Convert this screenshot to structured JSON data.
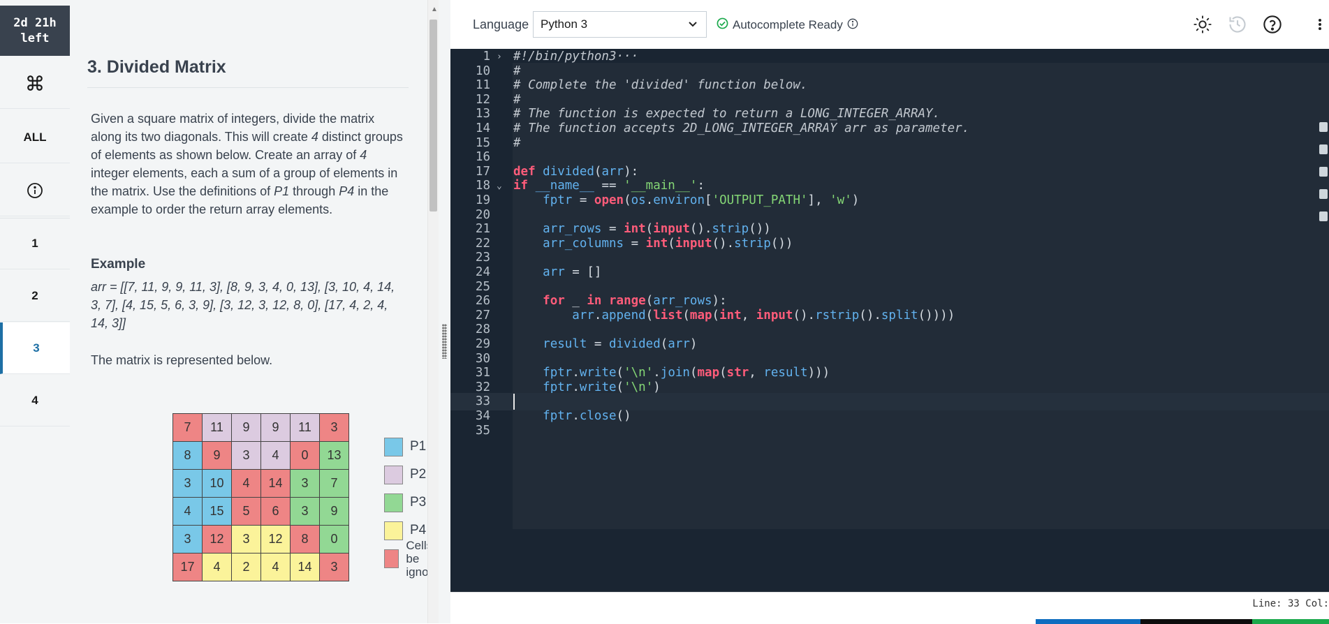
{
  "nav": {
    "timer_line1": "2d 21h",
    "timer_line2": "left",
    "all_label": "ALL",
    "items": [
      "1",
      "2",
      "3",
      "4"
    ],
    "active_item": "3"
  },
  "problem": {
    "title": "3. Divided Matrix",
    "p1_a": "Given a square matrix of integers, divide the matrix along its two diagonals. This will create ",
    "p1_n1": "4",
    "p1_b": " distinct groups of elements as shown below. Create an array of ",
    "p1_n2": "4",
    "p1_c": " integer elements, each a sum of a group of elements in the matrix. Use the definitions of ",
    "p1_n3": "P1",
    "p1_d": " through ",
    "p1_n4": "P4",
    "p1_e": " in the example to order the return array elements.",
    "example_heading": "Example",
    "example_arr": "arr = [[7, 11, 9, 9, 11, 3], [8, 9, 3, 4, 0, 13], [3, 10, 4, 14, 3, 7], [4, 15, 5, 6, 3, 9], [3, 12, 3, 12, 8, 0], [17, 4, 2, 4, 14, 3]]",
    "represented": "The matrix is represented below.",
    "matrix": [
      [
        {
          "v": "7",
          "g": "ig"
        },
        {
          "v": "11",
          "g": "p2"
        },
        {
          "v": "9",
          "g": "p2"
        },
        {
          "v": "9",
          "g": "p2"
        },
        {
          "v": "11",
          "g": "p2"
        },
        {
          "v": "3",
          "g": "ig"
        }
      ],
      [
        {
          "v": "8",
          "g": "p1"
        },
        {
          "v": "9",
          "g": "ig"
        },
        {
          "v": "3",
          "g": "p2"
        },
        {
          "v": "4",
          "g": "p2"
        },
        {
          "v": "0",
          "g": "ig"
        },
        {
          "v": "13",
          "g": "p3"
        }
      ],
      [
        {
          "v": "3",
          "g": "p1"
        },
        {
          "v": "10",
          "g": "p1"
        },
        {
          "v": "4",
          "g": "ig"
        },
        {
          "v": "14",
          "g": "ig"
        },
        {
          "v": "3",
          "g": "p3"
        },
        {
          "v": "7",
          "g": "p3"
        }
      ],
      [
        {
          "v": "4",
          "g": "p1"
        },
        {
          "v": "15",
          "g": "p1"
        },
        {
          "v": "5",
          "g": "ig"
        },
        {
          "v": "6",
          "g": "ig"
        },
        {
          "v": "3",
          "g": "p3"
        },
        {
          "v": "9",
          "g": "p3"
        }
      ],
      [
        {
          "v": "3",
          "g": "p1"
        },
        {
          "v": "12",
          "g": "ig"
        },
        {
          "v": "3",
          "g": "p4"
        },
        {
          "v": "12",
          "g": "p4"
        },
        {
          "v": "8",
          "g": "ig"
        },
        {
          "v": "0",
          "g": "p3"
        }
      ],
      [
        {
          "v": "17",
          "g": "ig"
        },
        {
          "v": "4",
          "g": "p4"
        },
        {
          "v": "2",
          "g": "p4"
        },
        {
          "v": "4",
          "g": "p4"
        },
        {
          "v": "14",
          "g": "p4"
        },
        {
          "v": "3",
          "g": "ig"
        }
      ]
    ],
    "legend": {
      "p1": "P1",
      "p2": "P2",
      "p3": "P3",
      "p4": "P4",
      "ignored_1": "Cells to be",
      "ignored_2": "ignored"
    }
  },
  "editor": {
    "language_label": "Language",
    "language_value": "Python 3",
    "autocomplete": "Autocomplete Ready",
    "status": "Line: 33 Col:",
    "lines": [
      {
        "n": "1",
        "fold": "›",
        "html": "<span class='cm'>#!/bin/python3···</span>"
      },
      {
        "n": "10",
        "html": "<span class='cm'>#</span>"
      },
      {
        "n": "11",
        "html": "<span class='cm'># Complete the 'divided' function below.</span>"
      },
      {
        "n": "12",
        "html": "<span class='cm'>#</span>"
      },
      {
        "n": "13",
        "html": "<span class='cm'># The function is expected to return a LONG_INTEGER_ARRAY.</span>"
      },
      {
        "n": "14",
        "html": "<span class='cm'># The function accepts 2D_LONG_INTEGER_ARRAY arr as parameter.</span>"
      },
      {
        "n": "15",
        "html": "<span class='cm'>#</span>"
      },
      {
        "n": "16",
        "html": ""
      },
      {
        "n": "17",
        "html": "<span class='kw'>def</span> <span class='fn'>divided</span>(<span class='fn'>arr</span>):"
      },
      {
        "n": "18",
        "fold": "⌄",
        "html": "<span class='kw'>if</span> <span class='fn'>__name__</span> == <span class='str'>'__main__'</span>:"
      },
      {
        "n": "19",
        "html": "    <span class='fn'>fptr</span> = <span class='kw'>open</span>(<span class='fn'>os</span>.<span class='fn'>environ</span>[<span class='str'>'OUTPUT_PATH'</span>], <span class='str'>'w'</span>)"
      },
      {
        "n": "20",
        "html": ""
      },
      {
        "n": "21",
        "html": "    <span class='fn'>arr_rows</span> = <span class='kw'>int</span>(<span class='kw'>input</span>().<span class='fn'>strip</span>())"
      },
      {
        "n": "22",
        "html": "    <span class='fn'>arr_columns</span> = <span class='kw'>int</span>(<span class='kw'>input</span>().<span class='fn'>strip</span>())"
      },
      {
        "n": "23",
        "html": ""
      },
      {
        "n": "24",
        "html": "    <span class='fn'>arr</span> = []"
      },
      {
        "n": "25",
        "html": ""
      },
      {
        "n": "26",
        "html": "    <span class='kw'>for</span> _ <span class='kw'>in</span> <span class='kw'>range</span>(<span class='fn'>arr_rows</span>):"
      },
      {
        "n": "27",
        "html": "        <span class='fn'>arr</span>.<span class='fn'>append</span>(<span class='kw'>list</span>(<span class='kw'>map</span>(<span class='kw'>int</span>, <span class='kw'>input</span>().<span class='fn'>rstrip</span>().<span class='fn'>split</span>())))"
      },
      {
        "n": "28",
        "html": ""
      },
      {
        "n": "29",
        "html": "    <span class='fn'>result</span> = <span class='fn'>divided</span>(<span class='fn'>arr</span>)"
      },
      {
        "n": "30",
        "html": ""
      },
      {
        "n": "31",
        "html": "    <span class='fn'>fptr</span>.<span class='fn'>write</span>(<span class='str'>'\\n'</span>.<span class='fn'>join</span>(<span class='kw'>map</span>(<span class='kw'>str</span>, <span class='fn'>result</span>)))"
      },
      {
        "n": "32",
        "html": "    <span class='fn'>fptr</span>.<span class='fn'>write</span>(<span class='str'>'\\n'</span>)"
      },
      {
        "n": "33",
        "cur": true,
        "html": ""
      },
      {
        "n": "34",
        "html": "    <span class='fn'>fptr</span>.<span class='fn'>close</span>()"
      },
      {
        "n": "35",
        "html": ""
      }
    ]
  },
  "colors": {
    "p1": "#79c8e8",
    "p2": "#dccbe0",
    "p3": "#92d894",
    "p4": "#fbf39a",
    "ignored": "#ee8585",
    "accent": "#1d6fa5",
    "editor_bg": "#1a2532"
  },
  "icons": {
    "shortcut": "command-icon",
    "info": "info-circle-icon",
    "theme": "sun-icon",
    "history": "history-icon",
    "help": "help-circle-icon",
    "more": "more-vertical-icon"
  }
}
